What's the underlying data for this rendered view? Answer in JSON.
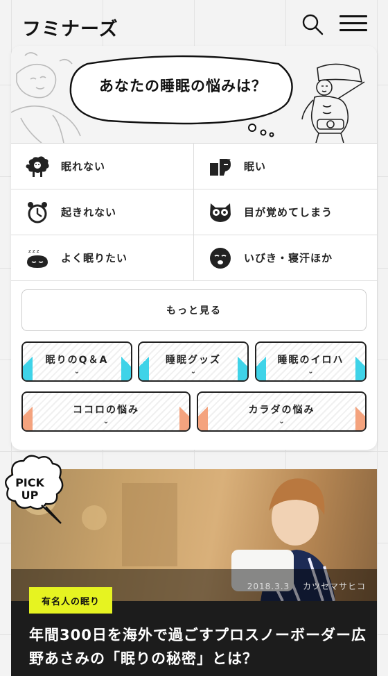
{
  "header": {
    "logo": "フミナーズ"
  },
  "hero": {
    "title": "あなたの睡眠の悩みは？"
  },
  "worries": [
    {
      "label": "眠れない",
      "icon": "sheep-icon"
    },
    {
      "label": "眠い",
      "icon": "sleepy-person-icon"
    },
    {
      "label": "起きれない",
      "icon": "alarm-clock-icon"
    },
    {
      "label": "目が覚めてしまう",
      "icon": "owl-icon"
    },
    {
      "label": "よく眠りたい",
      "icon": "sleeping-face-icon"
    },
    {
      "label": "いびき・寝汗ほか",
      "icon": "snoring-face-icon"
    }
  ],
  "more": {
    "label": "もっと見る"
  },
  "categories": [
    {
      "label": "眠りのQ＆A",
      "accent": "#3fd3e8"
    },
    {
      "label": "睡眠グッズ",
      "accent": "#3fd3e8"
    },
    {
      "label": "睡眠のイロハ",
      "accent": "#3fd3e8"
    },
    {
      "label": "ココロの悩み",
      "accent": "#f4a37e"
    },
    {
      "label": "カラダの悩み",
      "accent": "#f4a37e"
    }
  ],
  "pickup": {
    "badge_line1": "PICK",
    "badge_line2": "UP",
    "date": "2018.3.3",
    "author": "カツセマサヒコ",
    "tag": "有名人の眠り",
    "headline": "年間300日を海外で過ごすプロスノーボーダー広野あさみの「眠りの秘密」とは？"
  },
  "colors": {
    "tag_yellow": "#e6f321",
    "accent_cyan": "#3fd3e8",
    "accent_orange": "#f4a37e"
  }
}
